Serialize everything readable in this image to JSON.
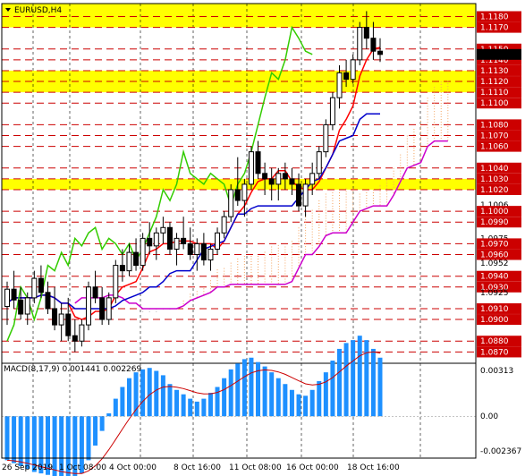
{
  "header": {
    "symbol_label": "EURUSD,H4",
    "macd_label": "MACD(8,17,9) 0.001441 0.002269"
  },
  "colors": {
    "background": "#ffffff",
    "zone_fill": "#ffff00",
    "dashed_level": "#cc0000",
    "level_label_bg": "#cc0000",
    "up_candle": "#000000",
    "down_candle": "#000000",
    "tenkan": "#ff0000",
    "kijun": "#0000cc",
    "chikou": "#33cc00",
    "senkou_b": "#cc00cc",
    "cloud_up": "#f4a460",
    "cloud_down": "#c0c0c0",
    "macd_hist": "#1e90ff",
    "macd_signal": "#cc0000",
    "grid": "#000000",
    "bollinger": "#66cc99"
  },
  "chart_data": [
    {
      "type": "candlestick",
      "title": "EURUSD,H4",
      "ylim": [
        1.0862,
        1.1192
      ],
      "y_ticks": [
        "1.1180",
        "1.1170",
        "1.1150",
        "1.1140",
        "1.1130",
        "1.1120",
        "1.1110",
        "1.1100",
        "1.0870",
        "1.1080",
        "1.1070",
        "1.1060",
        "1.1040",
        "1.1030",
        "1.1020",
        "1.1006",
        "1.1000",
        "1.0990",
        "1.0975",
        "1.0970",
        "1.0960",
        "1.0952",
        "1.0940",
        "1.0930",
        "1.0925",
        "1.0910",
        "1.0900",
        "1.0880",
        "1.0870"
      ],
      "y_ticks_highlighted": [
        "1.1180",
        "1.1170",
        "1.1150",
        "1.1140",
        "1.1130",
        "1.1120",
        "1.1110",
        "1.1100",
        "1.1080",
        "1.1070",
        "1.1060",
        "1.1040",
        "1.1030",
        "1.1020",
        "1.1000",
        "1.0990",
        "1.0970",
        "1.0960",
        "1.0940",
        "1.0930",
        "1.0910",
        "1.0900",
        "1.0880",
        "1.0870"
      ],
      "x_tick_labels": [
        "26 Sep 2019",
        "1 Oct 08:00",
        "4 Oct 00:00",
        "8 Oct 16:00",
        "11 Oct 08:00",
        "16 Oct 00:00",
        "18 Oct 16:00"
      ],
      "yellow_zones": [
        [
          1.117,
          1.1192
        ],
        [
          1.111,
          1.113
        ],
        [
          1.102,
          1.103
        ]
      ],
      "dashed_levels": [
        1.118,
        1.117,
        1.115,
        1.114,
        1.113,
        1.112,
        1.111,
        1.11,
        1.108,
        1.107,
        1.106,
        1.104,
        1.103,
        1.102,
        1.1,
        1.099,
        1.097,
        1.096,
        1.094,
        1.093,
        1.091,
        1.09,
        1.088,
        1.087
      ],
      "current_price": 1.1145,
      "candles": [
        [
          1.0912,
          1.0935,
          1.0895,
          1.0928
        ],
        [
          1.0928,
          1.0945,
          1.091,
          1.0918
        ],
        [
          1.0918,
          1.093,
          1.09,
          1.0905
        ],
        [
          1.0905,
          1.0925,
          1.0895,
          1.092
        ],
        [
          1.092,
          1.0945,
          1.0915,
          1.0938
        ],
        [
          1.0938,
          1.095,
          1.092,
          1.0925
        ],
        [
          1.0925,
          1.0935,
          1.0905,
          1.091
        ],
        [
          1.091,
          1.093,
          1.089,
          1.0895
        ],
        [
          1.0895,
          1.0915,
          1.088,
          1.0905
        ],
        [
          1.0905,
          1.092,
          1.088,
          1.0885
        ],
        [
          1.0885,
          1.09,
          1.087,
          1.088
        ],
        [
          1.088,
          1.09,
          1.0875,
          1.0895
        ],
        [
          1.0895,
          1.0935,
          1.089,
          1.093
        ],
        [
          1.093,
          1.0945,
          1.0915,
          1.092
        ],
        [
          1.092,
          1.093,
          1.0895,
          1.09
        ],
        [
          1.09,
          1.0925,
          1.0895,
          1.092
        ],
        [
          1.092,
          1.0955,
          1.0915,
          1.095
        ],
        [
          1.095,
          1.0965,
          1.0935,
          1.0945
        ],
        [
          1.0945,
          1.097,
          1.094,
          1.0962
        ],
        [
          1.0962,
          1.0975,
          1.0945,
          1.095
        ],
        [
          1.095,
          1.098,
          1.0945,
          1.0975
        ],
        [
          1.0975,
          1.099,
          1.096,
          1.0968
        ],
        [
          1.0968,
          1.0985,
          1.0955,
          1.098
        ],
        [
          1.098,
          1.0995,
          1.097,
          1.0985
        ],
        [
          1.0985,
          1.099,
          1.096,
          1.0965
        ],
        [
          1.0965,
          1.098,
          1.095,
          1.0975
        ],
        [
          1.0975,
          1.0995,
          1.0965,
          1.097
        ],
        [
          1.097,
          1.0985,
          1.0955,
          1.096
        ],
        [
          1.096,
          1.0975,
          1.0945,
          1.097
        ],
        [
          1.097,
          1.098,
          1.095,
          1.0955
        ],
        [
          1.0955,
          1.097,
          1.0945,
          1.0965
        ],
        [
          1.0965,
          1.0985,
          1.096,
          1.098
        ],
        [
          1.098,
          1.1,
          1.0975,
          1.0995
        ],
        [
          1.0995,
          1.1025,
          1.099,
          1.102
        ],
        [
          1.102,
          1.105,
          1.1005,
          1.101
        ],
        [
          1.101,
          1.103,
          1.0995,
          1.1025
        ],
        [
          1.1025,
          1.106,
          1.102,
          1.1055
        ],
        [
          1.1055,
          1.1065,
          1.103,
          1.1035
        ],
        [
          1.1035,
          1.1045,
          1.1015,
          1.103
        ],
        [
          1.103,
          1.104,
          1.101,
          1.1025
        ],
        [
          1.1025,
          1.104,
          1.101,
          1.1035
        ],
        [
          1.1035,
          1.1045,
          1.102,
          1.103
        ],
        [
          1.103,
          1.104,
          1.1015,
          1.1025
        ],
        [
          1.1025,
          1.1035,
          1.1,
          1.1005
        ],
        [
          1.1005,
          1.103,
          1.0995,
          1.1025
        ],
        [
          1.1025,
          1.1045,
          1.1015,
          1.1035
        ],
        [
          1.1035,
          1.106,
          1.103,
          1.1055
        ],
        [
          1.1055,
          1.1085,
          1.105,
          1.108
        ],
        [
          1.108,
          1.111,
          1.1075,
          1.1105
        ],
        [
          1.1105,
          1.1135,
          1.1095,
          1.1128
        ],
        [
          1.1128,
          1.114,
          1.1115,
          1.1122
        ],
        [
          1.1122,
          1.1145,
          1.1118,
          1.114
        ],
        [
          1.114,
          1.1175,
          1.1135,
          1.117
        ],
        [
          1.117,
          1.1185,
          1.115,
          1.116
        ],
        [
          1.116,
          1.1175,
          1.114,
          1.1148
        ],
        [
          1.1148,
          1.116,
          1.1138,
          1.1145
        ]
      ],
      "macd": {
        "hist": [
          -0.003,
          -0.0032,
          -0.0034,
          -0.0036,
          -0.0038,
          -0.0039,
          -0.004,
          -0.0041,
          -0.0042,
          -0.0042,
          -0.0041,
          -0.0039,
          -0.003,
          -0.002,
          -0.001,
          0.0002,
          0.0012,
          0.002,
          0.0026,
          0.003,
          0.0032,
          0.0033,
          0.0031,
          0.0028,
          0.0022,
          0.0018,
          0.0015,
          0.0012,
          0.001,
          0.0012,
          0.0016,
          0.002,
          0.0026,
          0.0032,
          0.0036,
          0.0039,
          0.004,
          0.0037,
          0.0034,
          0.003,
          0.0026,
          0.0022,
          0.0018,
          0.0015,
          0.0014,
          0.0018,
          0.0024,
          0.003,
          0.0038,
          0.0046,
          0.005,
          0.0052,
          0.0055,
          0.0052,
          0.0046,
          0.004
        ],
        "signal_last": 0.002269,
        "macd_last": 0.001441,
        "y_ticks": [
          "0.00313",
          "0.00",
          "-0.002367"
        ]
      }
    }
  ]
}
